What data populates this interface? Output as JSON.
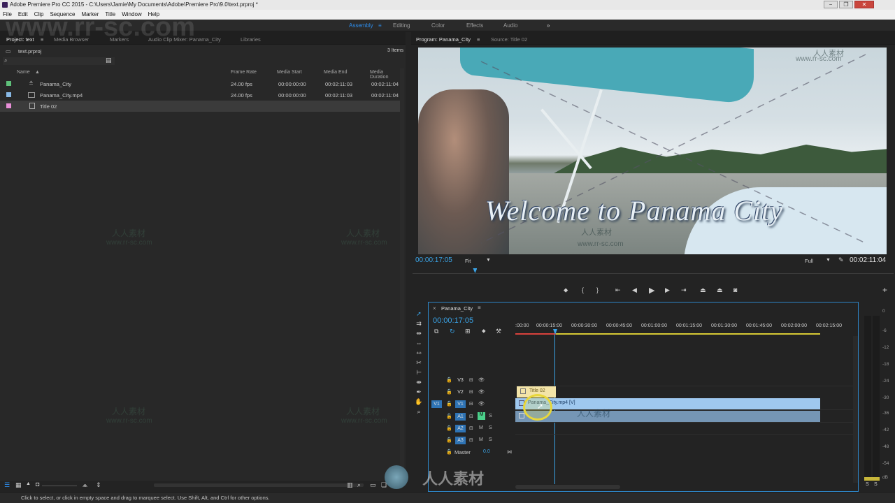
{
  "window": {
    "title": "Adobe Premiere Pro CC 2015 - C:\\Users\\Jamie\\My Documents\\Adobe\\Premiere Pro\\9.0\\text.prproj *",
    "buttons": [
      "−",
      "❐",
      "✕"
    ]
  },
  "menu": [
    "File",
    "Edit",
    "Clip",
    "Sequence",
    "Marker",
    "Title",
    "Window",
    "Help"
  ],
  "workspaces": {
    "items": [
      "Assembly",
      "Editing",
      "Color",
      "Effects",
      "Audio"
    ],
    "active": "Assembly",
    "overflow": "»"
  },
  "project": {
    "tabs": [
      "Project: text",
      "Media Browser",
      "Markers",
      "Audio Clip Mixer: Panama_City",
      "Libraries"
    ],
    "file": "text.prproj",
    "count": "3 Items",
    "columns": [
      "Name",
      "Frame Rate",
      "Media Start",
      "Media End",
      "Media Duration"
    ],
    "rows": [
      {
        "name": "Panama_City",
        "frame_rate": "24.00 fps",
        "start": "00:00:00:00",
        "end": "00:02:11:03",
        "duration": "00:02:11:04",
        "color": "#5ec07a"
      },
      {
        "name": "Panama_City.mp4",
        "frame_rate": "24.00 fps",
        "start": "00:00:00:00",
        "end": "00:02:11:03",
        "duration": "00:02:11:04",
        "color": "#88b9e6"
      },
      {
        "name": "Title 02",
        "frame_rate": "",
        "start": "",
        "end": "",
        "duration": "",
        "color": "#e88fd8"
      }
    ]
  },
  "program": {
    "tabs": [
      "Program: Panama_City",
      "Source: Title 02"
    ],
    "overlay_text": "Welcome to Panama City",
    "timecode": "00:00:17:05",
    "fit": "Fit",
    "quality": "Full",
    "duration": "00:02:11:04",
    "playhead_fraction": 0.13
  },
  "timeline": {
    "sequence": "Panama_City",
    "timecode": "00:00:17:05",
    "ruler": [
      ":00:00",
      "00:00:15:00",
      "00:00:30:00",
      "00:00:45:00",
      "00:01:00:00",
      "00:01:15:00",
      "00:01:30:00",
      "00:01:45:00",
      "00:02:00:00",
      "00:02:15:00"
    ],
    "video_tracks": [
      "V3",
      "V2",
      "V1"
    ],
    "audio_tracks": [
      "A1",
      "A2",
      "A3"
    ],
    "source_patch_v": "V1",
    "master_label": "Master",
    "master_value": "0.0",
    "clips": {
      "title": "Title 02",
      "video": "Panama_City.mp4 [V]"
    }
  },
  "meter": {
    "labels": [
      "0",
      "-6",
      "-12",
      "-18",
      "-24",
      "-30",
      "-36",
      "-42",
      "-48",
      "-54",
      "dB"
    ],
    "solo": [
      "S",
      "S"
    ]
  },
  "watermark": {
    "site": "www.rr-sc.com",
    "cn": "人人素材"
  },
  "status": "Click to select, or click in empty space and drag to marquee select. Use Shift, Alt, and Ctrl for other options."
}
